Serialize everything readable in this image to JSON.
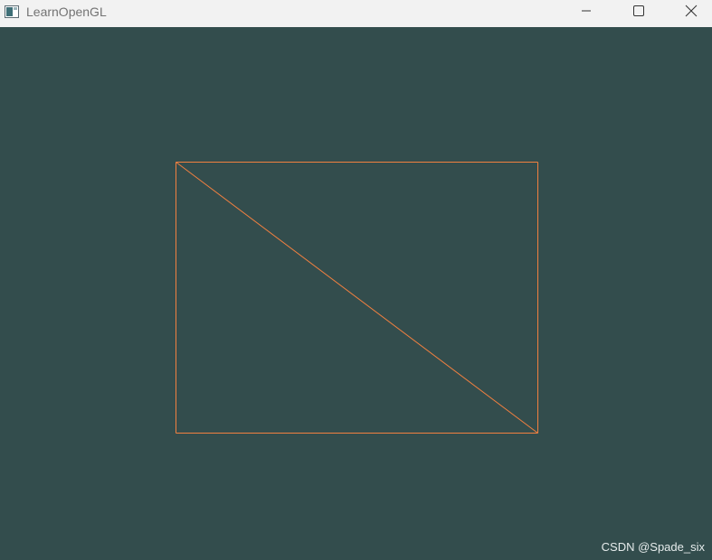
{
  "window": {
    "title": "LearnOpenGL",
    "icon": "window-app-icon",
    "controls": {
      "minimize_icon": "minimize-icon",
      "maximize_icon": "maximize-icon",
      "close_icon": "close-icon"
    }
  },
  "viewport": {
    "clear_color": "#334d4d",
    "wireframe_color": "#f28040",
    "primitive": "rectangle-wireframe-two-triangles"
  },
  "watermark": {
    "text": "CSDN @Spade_six"
  }
}
